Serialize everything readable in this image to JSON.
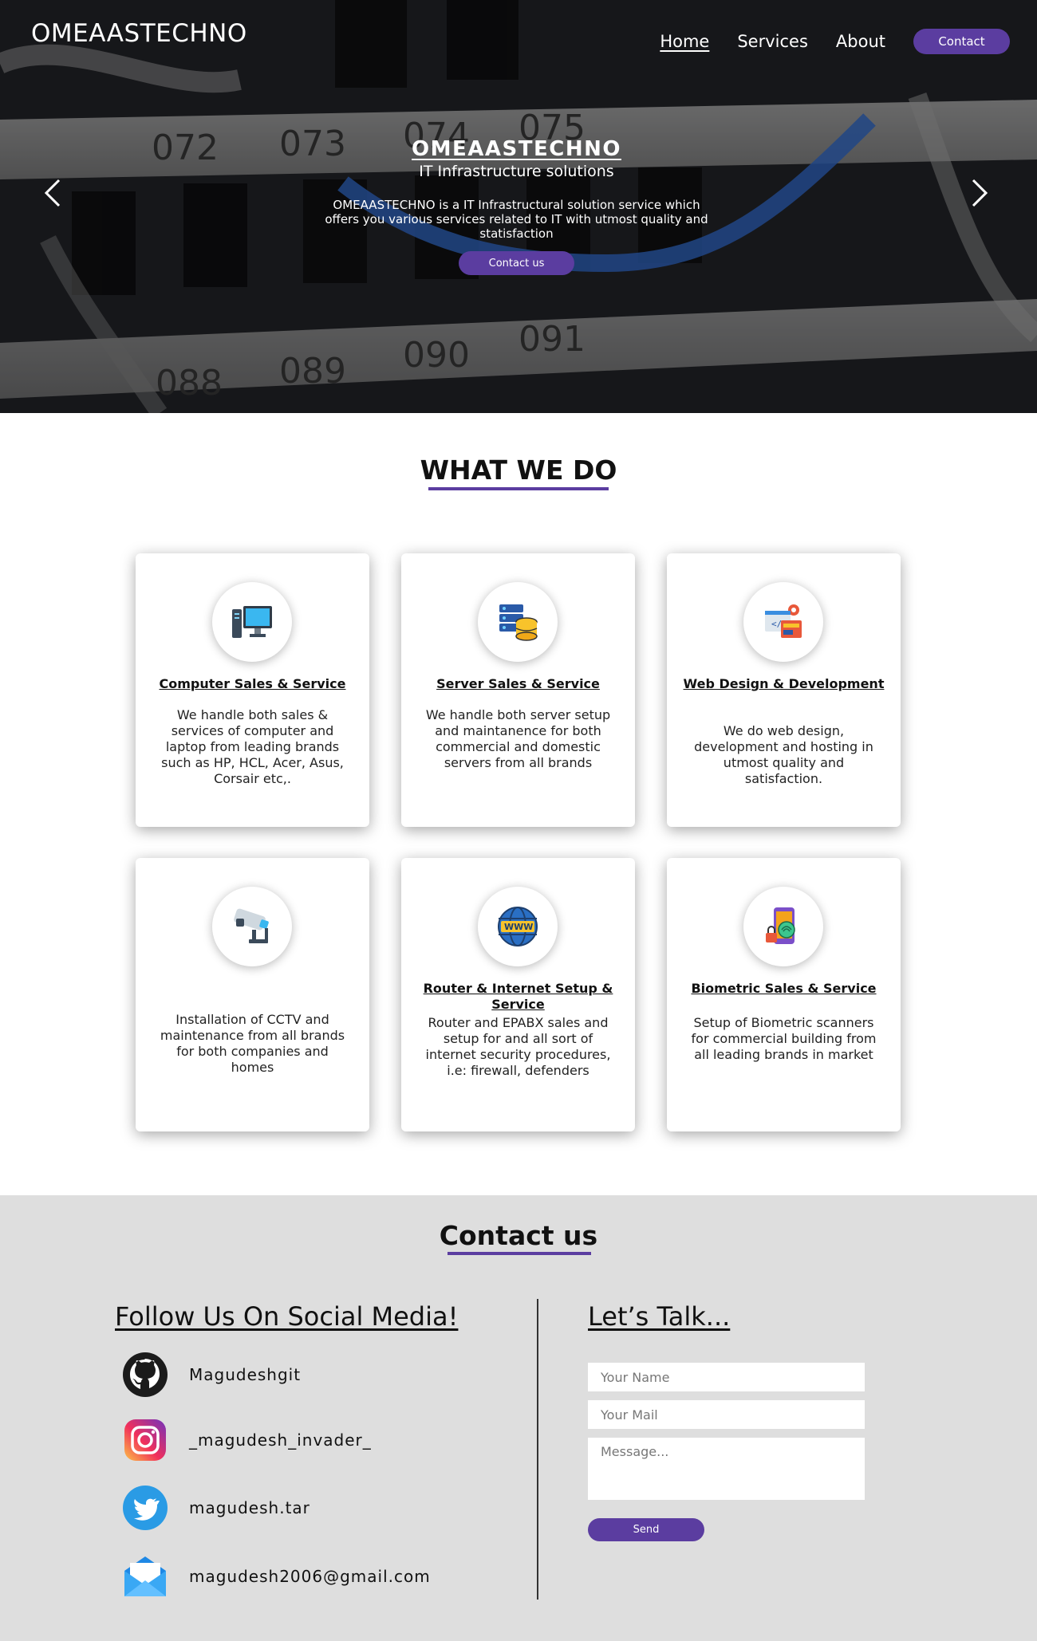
{
  "header": {
    "brand": "OMEAASTECHNO",
    "nav": {
      "home": "Home",
      "services": "Services",
      "about": "About",
      "contact": "Contact"
    }
  },
  "hero": {
    "title": "OMEAASTECHNO",
    "subtitle": "IT Infrastructure solutions",
    "description": "OMEAASTECHNO is a IT  Infrastructural solution service which offers you various services related to IT with utmost quality and statisfaction",
    "button": "Contact us",
    "prev_icon": "chevron-left-icon",
    "next_icon": "chevron-right-icon"
  },
  "services": {
    "title": "WHAT WE DO",
    "cards": [
      {
        "icon": "computer-icon",
        "title": "Computer Sales & Service",
        "text": "We handle both sales & services of computer and laptop from leading brands such as HP, HCL, Acer, Asus, Corsair etc,."
      },
      {
        "icon": "server-icon",
        "title": "Server Sales & Service",
        "text": "We handle both server setup and maintanence for both commercial and domestic servers from all brands"
      },
      {
        "icon": "web-design-icon",
        "title": "Web Design & Development",
        "text": "We do web design, development and hosting in utmost quality and satisfaction."
      },
      {
        "icon": "cctv-camera-icon",
        "title": "",
        "text": "Installation of CCTV  and maintenance from all brands for both companies and homes"
      },
      {
        "icon": "www-globe-icon",
        "title": "Router & Internet Setup & Service",
        "text": "Router and EPABX sales and setup for and all sort of internet security procedures, i.e: firewall, defenders"
      },
      {
        "icon": "biometric-icon",
        "title": "Biometric Sales & Service",
        "text": "Setup of Biometric scanners for commercial building from all leading brands in market"
      }
    ]
  },
  "contact": {
    "title": "Contact us",
    "follow_title": "Follow Us On Social Media!",
    "socials": [
      {
        "icon": "github-icon",
        "name": "Magudeshgit"
      },
      {
        "icon": "instagram-icon",
        "name": "_magudesh_invader_"
      },
      {
        "icon": "twitter-icon",
        "name": "magudesh.tar"
      },
      {
        "icon": "mail-icon",
        "name": "magudesh2006@gmail.com"
      }
    ],
    "talk_title": "Let’s Talk...",
    "form": {
      "name_placeholder": "Your Name",
      "mail_placeholder": "Your Mail",
      "message_placeholder": "Message...",
      "send_label": "Send"
    }
  },
  "colors": {
    "accent": "#5b3da0",
    "contact_bg": "#dedede"
  }
}
